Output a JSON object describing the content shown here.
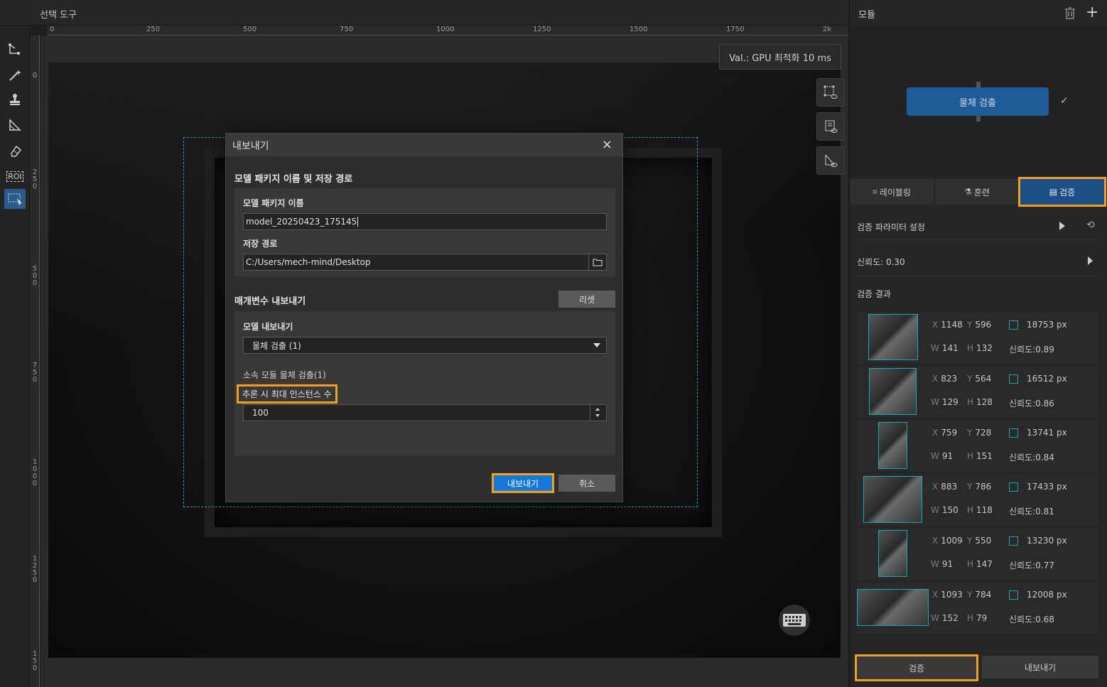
{
  "canvas": {
    "title": "선택 도구",
    "ruler_h": [
      "0",
      "250",
      "500",
      "750",
      "1000",
      "1250",
      "1500",
      "1750",
      "2k"
    ],
    "ruler_v": [
      "0",
      "2\n5\n0",
      "5\n0\n0",
      "7\n5\n0",
      "1\n0\n0\n0",
      "1\n2\n5\n0",
      "1\n5\n0"
    ],
    "val_label": "Val.:  GPU 최적화 10 ms",
    "roi_label": "ROI"
  },
  "dialog": {
    "title": "내보내기",
    "close": "×",
    "section1": "모델 패키지 이름 및 저장 경로",
    "pkg_label": "모델 패키지 이름",
    "pkg_value": "model_20250423_175145",
    "path_label": "저장 경로",
    "path_value": "C:/Users/mech-mind/Desktop",
    "section2": "매개변수 내보내기",
    "reset": "리셋",
    "model_export_label": "모델 내보내기",
    "model_select": "물체 검출 (1)",
    "sub_module": "소속 모듈 물체 검출(1)",
    "max_instances_label": "추론 시 최대 인스턴스 수",
    "max_instances_value": "100",
    "export_btn": "내보내기",
    "cancel_btn": "취소"
  },
  "right": {
    "title": "모듈",
    "module_node": "물체 검출",
    "tabs": [
      "레이블링",
      "훈련",
      "검증"
    ],
    "param_settings": "검증 파라미터 설정",
    "confidence": "신뢰도: 0.30",
    "results_title": "검증 결과",
    "results": [
      {
        "x": "1148",
        "y": "596",
        "w": "141",
        "h": "132",
        "area": "18753 px",
        "conf": "신뢰도:0.89"
      },
      {
        "x": "823",
        "y": "564",
        "w": "129",
        "h": "128",
        "area": "16512 px",
        "conf": "신뢰도:0.86"
      },
      {
        "x": "759",
        "y": "728",
        "w": "91",
        "h": "151",
        "area": "13741 px",
        "conf": "신뢰도:0.84"
      },
      {
        "x": "883",
        "y": "786",
        "w": "150",
        "h": "118",
        "area": "17433 px",
        "conf": "신뢰도:0.81"
      },
      {
        "x": "1009",
        "y": "550",
        "w": "91",
        "h": "147",
        "area": "13230 px",
        "conf": "신뢰도:0.77"
      },
      {
        "x": "1093",
        "y": "784",
        "w": "152",
        "h": "79",
        "area": "12008 px",
        "conf": "신뢰도:0.68"
      }
    ],
    "validate_btn": "검증",
    "export_btn": "내보내기"
  },
  "colors": {
    "accent": "#1f5a99",
    "highlight": "#f0a020",
    "roi": "#1aa3b5"
  }
}
